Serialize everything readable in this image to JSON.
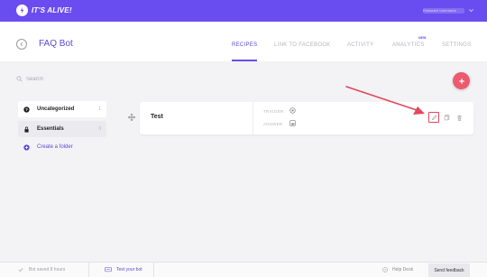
{
  "topbar": {
    "brand": "IT'S ALIVE!",
    "user_name": "Redacted Username"
  },
  "header": {
    "title": "FAQ Bot",
    "tabs": [
      {
        "label": "RECIPES",
        "active": true
      },
      {
        "label": "LINK TO FACEBOOK",
        "active": false
      },
      {
        "label": "ACTIVITY",
        "active": false
      },
      {
        "label": "ANALYTICS",
        "active": false,
        "badge": "NEW"
      },
      {
        "label": "SETTINGS",
        "active": false
      }
    ]
  },
  "search": {
    "placeholder": "Search"
  },
  "folders": [
    {
      "name": "Uncategorized",
      "count": "1"
    },
    {
      "name": "Essentials",
      "count": "0"
    }
  ],
  "create_folder": "Create a folder",
  "recipe": {
    "name": "Test",
    "trigger_label": "TRIGGER",
    "answer_label": "ANSWER"
  },
  "footer": {
    "saved": "Bot saved 8 hours",
    "test_bot": "Test your bot",
    "help": "Help Desk",
    "feedback": "Send feedback"
  },
  "colors": {
    "brand": "#6a4df0",
    "accent": "#ee5a6d",
    "highlight": "#e2475e"
  }
}
